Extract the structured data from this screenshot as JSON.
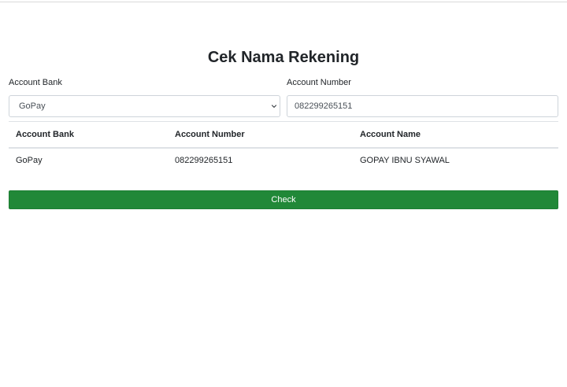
{
  "page": {
    "title": "Cek Nama Rekening"
  },
  "form": {
    "bank_label": "Account Bank",
    "bank_selected": "GoPay",
    "number_label": "Account Number",
    "number_value": "082299265151"
  },
  "table": {
    "headers": [
      "Account Bank",
      "Account Number",
      "Account Name"
    ],
    "rows": [
      [
        "GoPay",
        "082299265151",
        "GOPAY IBNU SYAWAL"
      ]
    ]
  },
  "actions": {
    "check_label": "Check"
  },
  "colors": {
    "button": "#218838"
  },
  "icons": {
    "select_arrow": "chevron-down-icon"
  }
}
